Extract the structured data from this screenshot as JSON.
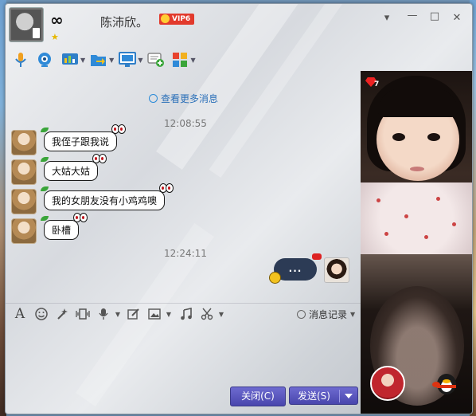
{
  "header": {
    "signature": "∞",
    "nickname": "陈沛欣。",
    "vip_label": "VIP6"
  },
  "window_controls": {
    "menu": "▾",
    "minimize": "—",
    "maximize": "□",
    "close": "✕"
  },
  "toolbar": {
    "items": [
      "microphone-icon",
      "camera-icon",
      "screen-share-icon",
      "file-transfer-icon",
      "remote-assist-icon",
      "add-group-chat-icon",
      "app-grid-icon"
    ]
  },
  "chat": {
    "view_more": "查看更多消息",
    "time_1": "12:08:55",
    "time_2": "12:24:11",
    "messages": [
      {
        "text": "我侄子跟我说"
      },
      {
        "text": "大姑大姑"
      },
      {
        "text": "我的女朋友没有小鸡鸡噢"
      },
      {
        "text": "卧槽"
      }
    ],
    "my_message": "..."
  },
  "input_toolbar": {
    "history_label": "消息记录"
  },
  "buttons": {
    "close": "关闭(C)",
    "send": "发送(S)"
  },
  "video": {
    "gem_count": "7"
  },
  "colors": {
    "accent_button": "#4946ad",
    "link": "#2a6fb8",
    "vip": "#e23a2c"
  }
}
